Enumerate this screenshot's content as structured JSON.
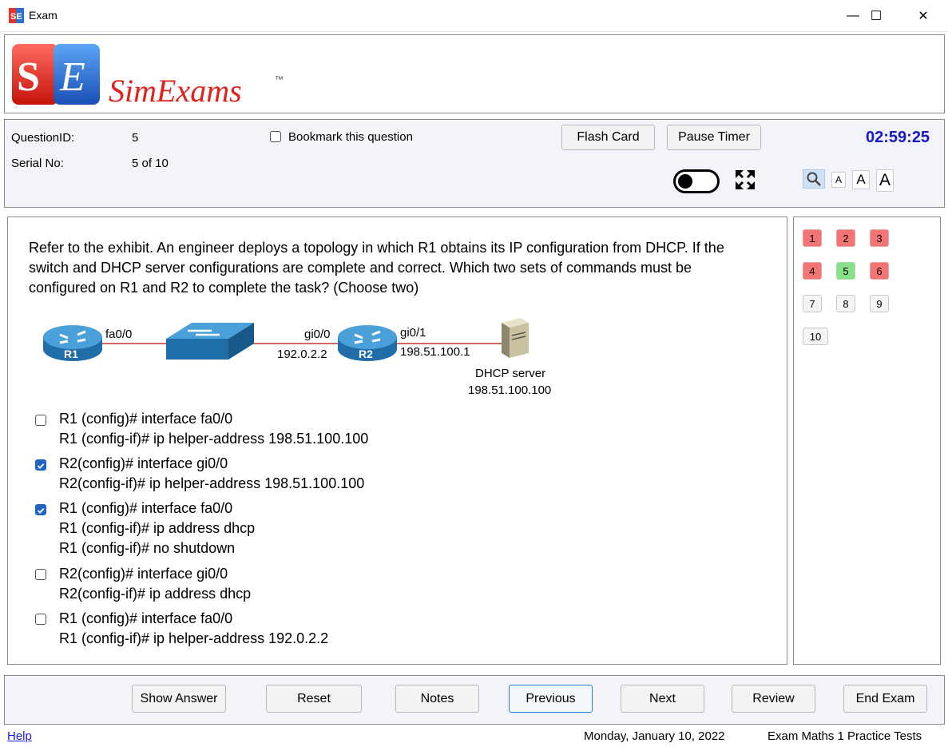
{
  "window": {
    "title": "Exam",
    "minimize": "—",
    "maximize": "☐",
    "close": "✕"
  },
  "logo": {
    "letters": "SE",
    "name": "SimExams",
    "tm": "™"
  },
  "info": {
    "question_id_label": "QuestionID:",
    "question_id": "5",
    "serial_label": "Serial No:",
    "serial": "5 of 10",
    "bookmark_label": "Bookmark this question",
    "bookmark_checked": false,
    "flash_card": "Flash Card",
    "pause_timer": "Pause Timer",
    "timer": "02:59:25",
    "font_small": "A",
    "font_medium": "A",
    "font_large": "A"
  },
  "question": {
    "text": "Refer to the exhibit. An engineer deploys a topology in which R1 obtains its IP configuration from DHCP. If the switch and DHCP server configurations are complete and correct. Which two sets of commands must be configured on R1 and R2 to complete the task? (Choose two)",
    "exhibit": {
      "r1": "R1",
      "r2": "R2",
      "fa0_0": "fa0/0",
      "gi0_0": "gi0/0",
      "r2_ip": "192.0.2.2",
      "gi0_1": "gi0/1",
      "r2_ip2": "198.51.100.1",
      "dhcp_label": "DHCP server",
      "dhcp_ip": "198.51.100.100"
    },
    "answers": [
      {
        "checked": false,
        "lines": [
          "R1 (config)# interface fa0/0",
          "R1 (config-if)# ip helper-address 198.51.100.100"
        ]
      },
      {
        "checked": true,
        "lines": [
          "R2(config)# interface gi0/0",
          "R2(config-if)# ip helper-address 198.51.100.100"
        ]
      },
      {
        "checked": true,
        "lines": [
          "R1 (config)# interface fa0/0",
          "R1 (config-if)# ip address dhcp",
          "R1 (config-if)# no shutdown"
        ]
      },
      {
        "checked": false,
        "lines": [
          "R2(config)# interface gi0/0",
          "R2(config-if)# ip address dhcp"
        ]
      },
      {
        "checked": false,
        "lines": [
          "R1 (config)# interface fa0/0",
          "R1 (config-if)# ip helper-address 192.0.2.2"
        ]
      }
    ]
  },
  "navigator": [
    {
      "label": "1",
      "status": "red"
    },
    {
      "label": "2",
      "status": "red"
    },
    {
      "label": "3",
      "status": "red"
    },
    {
      "label": "4",
      "status": "red"
    },
    {
      "label": "5",
      "status": "green"
    },
    {
      "label": "6",
      "status": "red"
    },
    {
      "label": "7",
      "status": "none"
    },
    {
      "label": "8",
      "status": "none"
    },
    {
      "label": "9",
      "status": "none"
    },
    {
      "label": "10",
      "status": "none"
    }
  ],
  "buttons": {
    "show_answer": "Show Answer",
    "reset": "Reset",
    "notes": "Notes",
    "previous": "Previous",
    "next": "Next",
    "review": "Review",
    "end_exam": "End Exam"
  },
  "status": {
    "help": "Help",
    "date": "Monday, January 10, 2022",
    "product": "Exam Maths 1 Practice Tests"
  },
  "colors": {
    "timer": "#1717c8",
    "status_red": "#f27474",
    "status_green": "#89e089",
    "check_accent": "#1f66c4",
    "panel_bg": "#f2f4fa"
  }
}
